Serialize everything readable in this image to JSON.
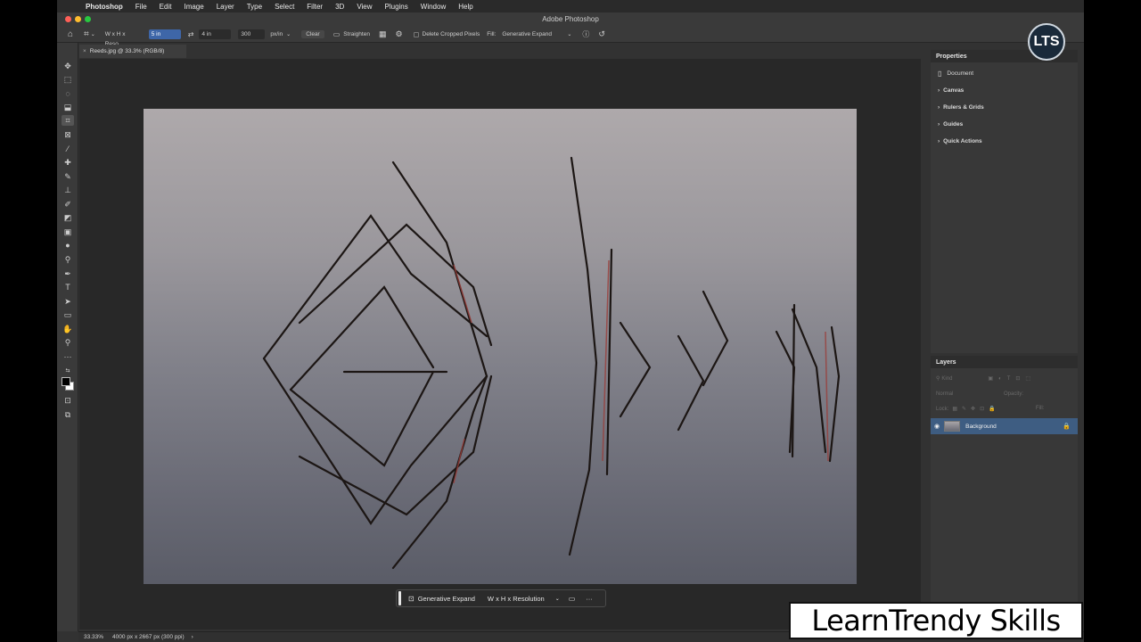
{
  "menubar": {
    "app_name": "Photoshop",
    "items": [
      "File",
      "Edit",
      "Image",
      "Layer",
      "Type",
      "Select",
      "Filter",
      "3D",
      "View",
      "Plugins",
      "Window",
      "Help"
    ]
  },
  "window": {
    "title": "Adobe Photoshop"
  },
  "options": {
    "ratio_preset": "W x H x Reso...",
    "width_value": "5 in",
    "height_value": "4 in",
    "resolution_value": "300",
    "resolution_unit": "px/in",
    "clear_label": "Clear",
    "straighten_label": "Straighten",
    "delete_cropped_label": "Delete Cropped Pixels",
    "fill_label": "Fill:",
    "fill_value": "Generative Expand"
  },
  "document": {
    "tab_label": "Reeds.jpg @ 33.3% (RGB/8)"
  },
  "properties": {
    "title": "Properties",
    "document_label": "Document",
    "sections": [
      "Canvas",
      "Rulers & Grids",
      "Guides",
      "Quick Actions"
    ]
  },
  "layers": {
    "title": "Layers",
    "kind_placeholder": "Kind",
    "blend_mode": "Normal",
    "opacity_label": "Opacity:",
    "lock_label": "Lock:",
    "fill_label": "Fill:",
    "layer_name": "Background"
  },
  "taskbar": {
    "generative_expand_label": "Generative Expand",
    "dropdown_value": "W x H x Resolution",
    "more_label": "···"
  },
  "status": {
    "zoom": "33.33%",
    "doc_info": "4000 px x 2667 px (300 ppi)"
  },
  "overlay": {
    "watermark": "LearnTrendy Skills",
    "logo_text": "LTS"
  },
  "colors": {
    "accent_selection": "#3e66a8",
    "layer_selected": "#3e5d82",
    "close": "#fe5f57",
    "minimize": "#febc2e",
    "zoom": "#28c840"
  }
}
